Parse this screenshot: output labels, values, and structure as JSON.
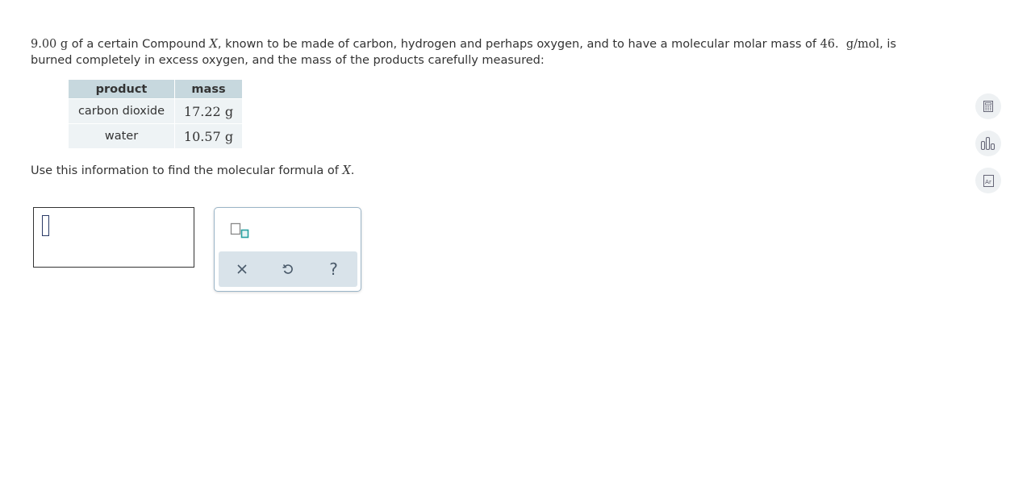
{
  "question": {
    "mass_value": "9.00",
    "mass_unit": "g",
    "text_1": " of a certain Compound ",
    "compound_var": "X",
    "text_2": ", known to be made of carbon, hydrogen and perhaps oxygen, and to have a molecular molar mass of ",
    "molar_mass_value": "46.",
    "molar_mass_unit": "g/mol",
    "text_3": ", is burned completely in excess oxygen, and the mass of the products carefully measured:"
  },
  "table": {
    "headers": [
      "product",
      "mass"
    ],
    "rows": [
      {
        "product": "carbon dioxide",
        "mass": "17.22 g"
      },
      {
        "product": "water",
        "mass": "10.57 g"
      }
    ]
  },
  "instruction": {
    "text": "Use this information to find the molecular formula of ",
    "var": "X",
    "end": "."
  },
  "answer": {
    "value": ""
  },
  "icons": {
    "palette_tool": "subscript-template-icon",
    "clear": "x-icon",
    "undo": "undo-icon",
    "help": "question-mark-icon",
    "side_tools": [
      "calculator-icon",
      "bar-chart-icon",
      "periodic-table-icon"
    ]
  },
  "side_tools": {
    "periodic_table_label": "Ar"
  },
  "palette_labels": {
    "help": "?",
    "clear": "×"
  },
  "colors": {
    "header_bg": "#c7d8de",
    "cell_bg": "#eef3f5",
    "accent": "#26a0a0"
  }
}
